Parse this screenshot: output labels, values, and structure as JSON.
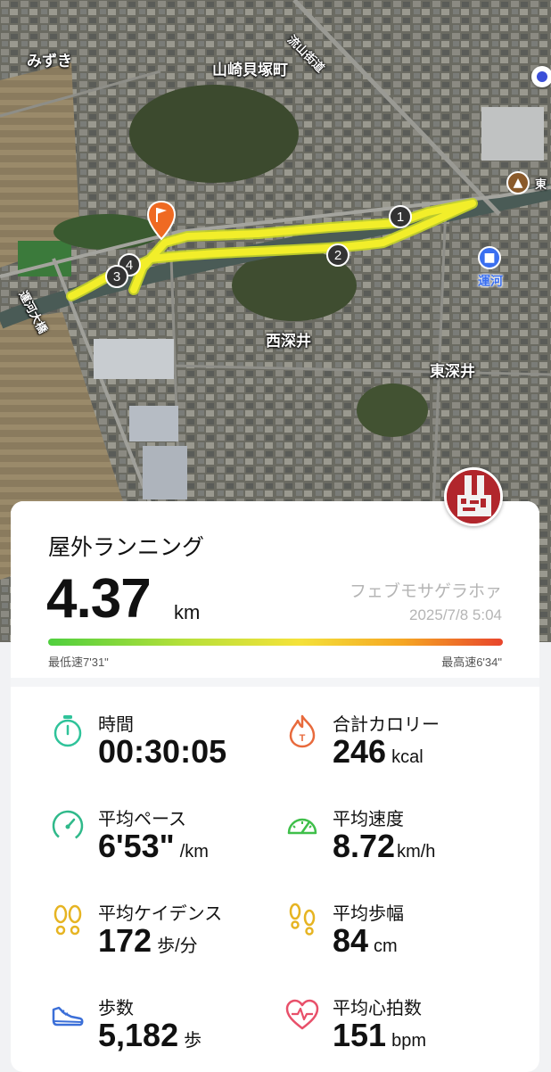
{
  "map": {
    "labels": {
      "mizuki": "みずき",
      "yamazaki": "山崎貝塚町",
      "nagareyama_road": "流山街道",
      "nishifukai": "西深井",
      "higashifukai": "東深井",
      "unga": "運河",
      "higashi": "東",
      "bridge": "運河大橋"
    },
    "split_markers": [
      "1",
      "2",
      "3",
      "4"
    ]
  },
  "workout": {
    "type": "屋外ランニング",
    "distance": "4.37",
    "distance_unit": "km",
    "user": "フェブモサゲラホァ",
    "datetime": "2025/7/8 5:04",
    "slowest_pace": "最低速7'31\"",
    "fastest_pace": "最高速6'34\""
  },
  "stats": {
    "time": {
      "label": "時間",
      "value": "00:30:05",
      "unit": ""
    },
    "calories": {
      "label": "合計カロリー",
      "value": "246",
      "unit": "kcal"
    },
    "avg_pace": {
      "label": "平均ペース",
      "value": "6'53\"",
      "unit": "/km"
    },
    "avg_speed": {
      "label": "平均速度",
      "value": "8.72",
      "unit": "km/h"
    },
    "cadence": {
      "label": "平均ケイデンス",
      "value": "172",
      "unit": "歩/分"
    },
    "stride": {
      "label": "平均歩幅",
      "value": "84",
      "unit": "cm"
    },
    "steps": {
      "label": "歩数",
      "value": "5,182",
      "unit": "歩"
    },
    "heart_rate": {
      "label": "平均心拍数",
      "value": "151",
      "unit": "bpm"
    }
  },
  "colors": {
    "time_icon": "#2fc39a",
    "calorie_icon": "#e86a3c",
    "pace_icon": "#2fb98a",
    "speed_icon": "#3fbf4a",
    "cadence_icon": "#e6b422",
    "stride_icon": "#e6b422",
    "steps_icon": "#3b6fd8",
    "heart_icon": "#e8506a",
    "route": "#f2ee2a"
  }
}
